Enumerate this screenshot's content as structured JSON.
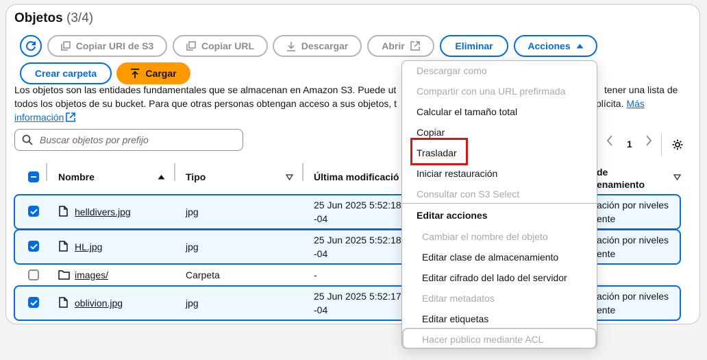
{
  "header": {
    "title": "Objetos",
    "count": "(3/4)"
  },
  "toolbar": {
    "copy_uri": "Copiar URI de S3",
    "copy_url": "Copiar URL",
    "download": "Descargar",
    "open": "Abrir",
    "delete": "Eliminar",
    "actions": "Acciones",
    "create_folder": "Crear carpeta",
    "upload": "Cargar"
  },
  "description": {
    "line1": "Los objetos son las entidades fundamentales que se almacenan en Amazon S3. Puede ut",
    "line2": "todos los objetos de su bucket. Para que otras personas obtengan acceso a sus objetos, t",
    "more_link_1": "Más",
    "more_link_2": "información",
    "right_line1": "tener una lista de",
    "right_line2": "plícita."
  },
  "search": {
    "placeholder": "Buscar objetos por prefijo"
  },
  "pagination": {
    "page": "1"
  },
  "table": {
    "columns": {
      "name": "Nombre",
      "type": "Tipo",
      "modified": "Última modificació",
      "storage_line1": "de",
      "storage_line2": "enamiento"
    },
    "rows": [
      {
        "name": "helldivers.jpg",
        "type": "jpg",
        "modified_1": "25 Jun 2025 5:52:18",
        "modified_2": "-04",
        "storage_1": "ación por niveles",
        "storage_2": "ente",
        "checked": true
      },
      {
        "name": "HL.jpg",
        "type": "jpg",
        "modified_1": "25 Jun 2025 5:52:18",
        "modified_2": "-04",
        "storage_1": "ación por niveles",
        "storage_2": "ente",
        "checked": true
      },
      {
        "name": "images/",
        "type": "Carpeta",
        "modified_1": "-",
        "modified_2": "",
        "storage_1": "",
        "storage_2": "",
        "checked": false
      },
      {
        "name": "oblivion.jpg",
        "type": "jpg",
        "modified_1": "25 Jun 2025 5:52:17",
        "modified_2": "-04",
        "storage_1": "ación por niveles",
        "storage_2": "ente",
        "checked": true
      }
    ]
  },
  "menu": {
    "items": [
      {
        "label": "Descargar como",
        "disabled": true
      },
      {
        "label": "Compartir con una URL prefirmada",
        "disabled": true
      },
      {
        "label": "Calcular el tamaño total",
        "disabled": false
      },
      {
        "label": "Copiar",
        "disabled": false
      },
      {
        "label": "Trasladar",
        "disabled": false
      },
      {
        "label": "Iniciar restauración",
        "disabled": false
      },
      {
        "label": "Consultar con S3 Select",
        "disabled": true
      }
    ],
    "group_label": "Editar acciones",
    "group_items": [
      {
        "label": "Cambiar el nombre del objeto",
        "disabled": true
      },
      {
        "label": "Editar clase de almacenamiento",
        "disabled": false
      },
      {
        "label": "Editar cifrado del lado del servidor",
        "disabled": false
      },
      {
        "label": "Editar metadatos",
        "disabled": true
      },
      {
        "label": "Editar etiquetas",
        "disabled": false
      },
      {
        "label": "Hacer público mediante ACL",
        "disabled": true
      }
    ]
  },
  "colors": {
    "primary": "#006ce0",
    "orange": "#ff9900",
    "highlight": "#d91515"
  }
}
